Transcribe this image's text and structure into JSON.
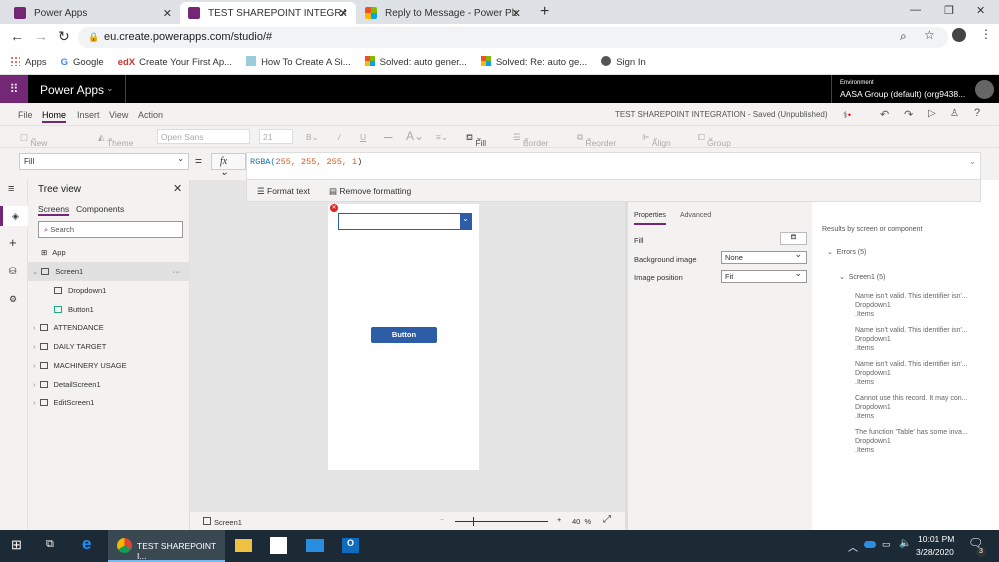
{
  "browser": {
    "tabs": [
      {
        "title": "Power Apps",
        "active": false
      },
      {
        "title": "TEST SHAREPOINT INTEGRATION",
        "active": true
      },
      {
        "title": "Reply to Message - Power Platfor",
        "active": false
      }
    ],
    "url": "eu.create.powerapps.com/studio/#",
    "bookmarks": [
      "Apps",
      "Google",
      "Create Your First Ap...",
      "How To Create A Si...",
      "Solved: auto gener...",
      "Solved: Re: auto ge...",
      "Sign In"
    ]
  },
  "header": {
    "app_name": "Power Apps",
    "env_label": "Environment",
    "env_value": "AASA Group (default) (org9438..."
  },
  "menu": {
    "items": [
      "File",
      "Home",
      "Insert",
      "View",
      "Action"
    ],
    "active": "Home",
    "doc_status": "TEST SHAREPOINT INTEGRATION - Saved (Unpublished)"
  },
  "toolbar": {
    "new_screen": "New screen",
    "theme": "Theme",
    "font": "Open Sans",
    "size": "21",
    "fill": "Fill",
    "border": "Border",
    "reorder": "Reorder",
    "align": "Align",
    "group": "Group"
  },
  "formula": {
    "property": "Fill",
    "fx": "fx",
    "fn": "RGBA(",
    "args": "255, 255, 255, 1",
    "close": ")",
    "format_text": "Format text",
    "remove_formatting": "Remove formatting"
  },
  "tree": {
    "title": "Tree view",
    "tabs": [
      "Screens",
      "Components"
    ],
    "search_placeholder": "Search",
    "items": [
      {
        "label": "App"
      },
      {
        "label": "Screen1"
      },
      {
        "label": "Dropdown1"
      },
      {
        "label": "Button1"
      },
      {
        "label": "ATTENDANCE"
      },
      {
        "label": "DAILY TARGET"
      },
      {
        "label": "MACHINERY USAGE"
      },
      {
        "label": "DetailScreen1"
      },
      {
        "label": "EditScreen1"
      }
    ]
  },
  "canvas": {
    "button_label": "Button",
    "button_color": "#2e5da8"
  },
  "status": {
    "screen": "Screen1",
    "zoom": "40",
    "zoom_unit": "%"
  },
  "properties": {
    "tabs": [
      "Properties",
      "Advanced"
    ],
    "fill_label": "Fill",
    "bg_label": "Background image",
    "bg_value": "None",
    "pos_label": "Image position",
    "pos_value": "Fit"
  },
  "results": {
    "title": "Results by screen or component",
    "errors": "Errors (5)",
    "screen": "Screen1 (5)",
    "items": [
      {
        "msg": "Name isn't valid. This identifier isn'...",
        "control": "Dropdown1",
        "prop": ".Items"
      },
      {
        "msg": "Name isn't valid. This identifier isn'...",
        "control": "Dropdown1",
        "prop": ".Items"
      },
      {
        "msg": "Name isn't valid. This identifier isn'...",
        "control": "Dropdown1",
        "prop": ".Items"
      },
      {
        "msg": "Cannot use this record. It may con...",
        "control": "Dropdown1",
        "prop": ".Items"
      },
      {
        "msg": "The function 'Table' has some inva...",
        "control": "Dropdown1",
        "prop": ".Items"
      }
    ]
  },
  "taskbar": {
    "chrome_task": "TEST SHAREPOINT I...",
    "time": "10:01 PM",
    "date": "3/28/2020",
    "notifications": "3"
  },
  "colors": {
    "accent": "#742774",
    "header": "#000000"
  }
}
